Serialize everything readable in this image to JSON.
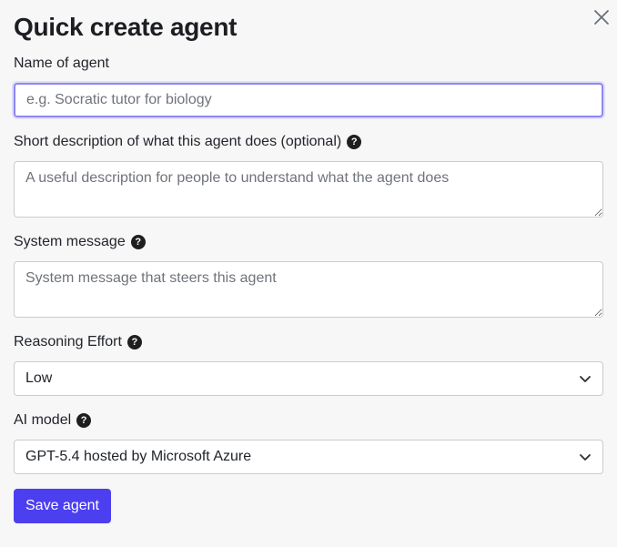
{
  "dialog": {
    "title": "Quick create agent",
    "close_icon": "close-icon"
  },
  "fields": {
    "name": {
      "label": "Name of agent",
      "placeholder": "e.g. Socratic tutor for biology",
      "value": ""
    },
    "description": {
      "label": "Short description of what this agent does (optional)",
      "placeholder": "A useful description for people to understand what the agent does",
      "help_icon": "question-icon"
    },
    "system_message": {
      "label": "System message",
      "placeholder": "System message that steers this agent",
      "help_icon": "question-icon"
    },
    "reasoning_effort": {
      "label": "Reasoning Effort",
      "value": "Low",
      "help_icon": "question-icon"
    },
    "ai_model": {
      "label": "AI model",
      "value": "GPT-5.4 hosted by Microsoft Azure",
      "help_icon": "question-icon"
    }
  },
  "actions": {
    "save_label": "Save agent"
  },
  "help_glyph": "?",
  "colors": {
    "accent": "#4c3ff0",
    "focus_ring": "#8d87f1",
    "background": "#f7f7f8"
  }
}
